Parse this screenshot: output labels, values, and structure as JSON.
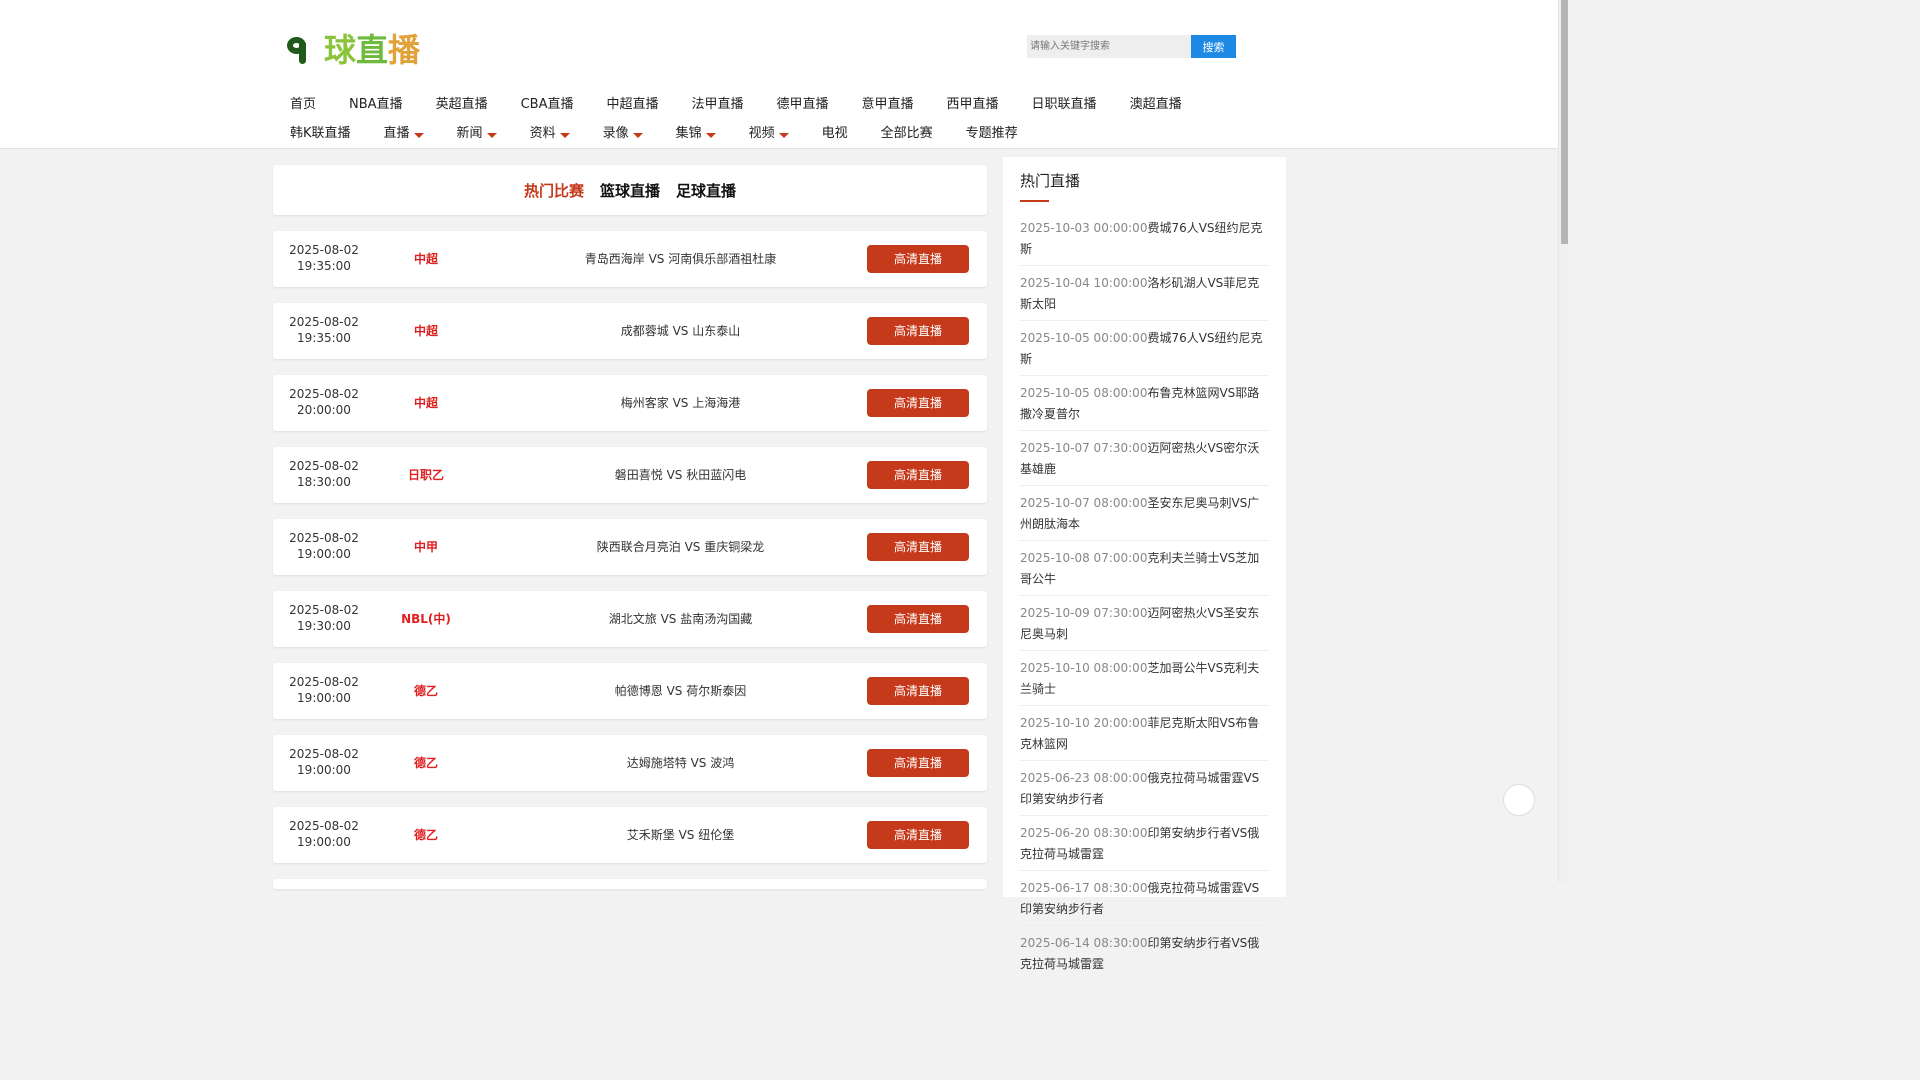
{
  "logo": {
    "text": [
      "球",
      "直",
      "播",
      ""
    ],
    "mark": "9"
  },
  "search": {
    "placeholder": "请输入关键字搜索",
    "button": "搜索"
  },
  "nav": {
    "row1": [
      "首页",
      "NBA直播",
      "英超直播",
      "CBA直播",
      "中超直播",
      "法甲直播",
      "德甲直播",
      "意甲直播",
      "西甲直播",
      "日职联直播",
      "澳超直播"
    ],
    "row2": [
      {
        "label": "韩K联直播",
        "dropdown": false
      },
      {
        "label": "直播",
        "dropdown": true
      },
      {
        "label": "新闻",
        "dropdown": true
      },
      {
        "label": "资料",
        "dropdown": true
      },
      {
        "label": "录像",
        "dropdown": true
      },
      {
        "label": "集锦",
        "dropdown": true
      },
      {
        "label": "视频",
        "dropdown": true
      },
      {
        "label": "电视",
        "dropdown": false
      },
      {
        "label": "全部比赛",
        "dropdown": false
      },
      {
        "label": "专题推荐",
        "dropdown": false
      }
    ]
  },
  "tabs": {
    "hot": "热门比赛",
    "basketball": "篮球直播",
    "football": "足球直播"
  },
  "matches": [
    {
      "date": "2025-08-02",
      "time": "19:35:00",
      "league": "中超",
      "teams": "青岛西海岸 VS 河南俱乐部酒祖杜康",
      "button": "高清直播"
    },
    {
      "date": "2025-08-02",
      "time": "19:35:00",
      "league": "中超",
      "teams": "成都蓉城 VS 山东泰山",
      "button": "高清直播"
    },
    {
      "date": "2025-08-02",
      "time": "20:00:00",
      "league": "中超",
      "teams": "梅州客家 VS 上海海港",
      "button": "高清直播"
    },
    {
      "date": "2025-08-02",
      "time": "18:30:00",
      "league": "日职乙",
      "teams": "磐田喜悦 VS 秋田蓝闪电",
      "button": "高清直播"
    },
    {
      "date": "2025-08-02",
      "time": "19:00:00",
      "league": "中甲",
      "teams": "陕西联合月亮泊 VS 重庆铜梁龙",
      "button": "高清直播"
    },
    {
      "date": "2025-08-02",
      "time": "19:30:00",
      "league": "NBL(中)",
      "teams": "湖北文旅 VS 盐南汤沟国藏",
      "button": "高清直播"
    },
    {
      "date": "2025-08-02",
      "time": "19:00:00",
      "league": "德乙",
      "teams": "帕德博恩 VS 荷尔斯泰因",
      "button": "高清直播"
    },
    {
      "date": "2025-08-02",
      "time": "19:00:00",
      "league": "德乙",
      "teams": "达姆施塔特 VS 波鸿",
      "button": "高清直播"
    },
    {
      "date": "2025-08-02",
      "time": "19:00:00",
      "league": "德乙",
      "teams": "艾禾斯堡 VS 纽伦堡",
      "button": "高清直播"
    }
  ],
  "sidebar": {
    "title": "热门直播",
    "items": [
      {
        "dt": "2025-10-03 00:00:00",
        "title": "费城76人VS纽约尼克斯"
      },
      {
        "dt": "2025-10-04 10:00:00",
        "title": "洛杉矶湖人VS菲尼克斯太阳"
      },
      {
        "dt": "2025-10-05 00:00:00",
        "title": "费城76人VS纽约尼克斯"
      },
      {
        "dt": "2025-10-05 08:00:00",
        "title": "布鲁克林篮网VS耶路撒冷夏普尔"
      },
      {
        "dt": "2025-10-07 07:30:00",
        "title": "迈阿密热火VS密尔沃基雄鹿"
      },
      {
        "dt": "2025-10-07 08:00:00",
        "title": "圣安东尼奥马刺VS广州朗肽海本"
      },
      {
        "dt": "2025-10-08 07:00:00",
        "title": "克利夫兰骑士VS芝加哥公牛"
      },
      {
        "dt": "2025-10-09 07:30:00",
        "title": "迈阿密热火VS圣安东尼奥马刺"
      },
      {
        "dt": "2025-10-10 08:00:00",
        "title": "芝加哥公牛VS克利夫兰骑士"
      },
      {
        "dt": "2025-10-10 20:00:00",
        "title": "菲尼克斯太阳VS布鲁克林篮网"
      },
      {
        "dt": "2025-06-23 08:00:00",
        "title": "俄克拉荷马城雷霆VS印第安纳步行者"
      },
      {
        "dt": "2025-06-20 08:30:00",
        "title": "印第安纳步行者VS俄克拉荷马城雷霆"
      },
      {
        "dt": "2025-06-17 08:30:00",
        "title": "俄克拉荷马城雷霆VS印第安纳步行者"
      },
      {
        "dt": "2025-06-14 08:30:00",
        "title": "印第安纳步行者VS俄克拉荷马城雷霆"
      }
    ]
  },
  "colors": {
    "accent": "#c53a1b",
    "search_button": "#1e88e5",
    "league": "#e02020"
  }
}
